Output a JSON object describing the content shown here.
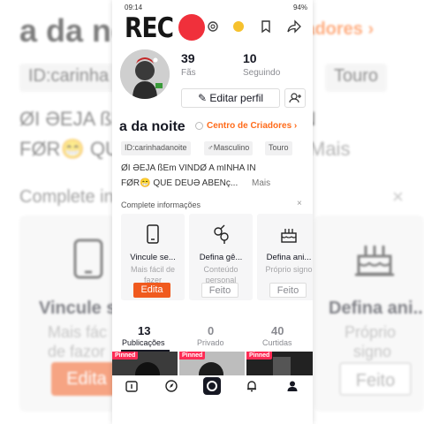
{
  "status_bar": {
    "time": "09:14",
    "battery": "94%"
  },
  "overlay": {
    "rec_label": "REC"
  },
  "profile": {
    "following_count": "39",
    "following_label": "Fãs",
    "followers_count": "10",
    "followers_label": "Seguindo",
    "edit_profile_label": "Editar perfil",
    "nickname": "a da noite",
    "creator_center_label": "Centro de Criadores ›",
    "tags": [
      "ID:carinhadanoite",
      "♂Masculino",
      "Touro"
    ],
    "bio_line1": "ØI ƏEJA ßEm VINDØ A mINHA IN",
    "bio_line2": "FØR😁 QUE DEUƏ ABENç...",
    "bio_more": "Mais"
  },
  "complete_info": {
    "title": "Complete informações",
    "close": "×",
    "cards": [
      {
        "title": "Vincule se...",
        "subtitle": "Mais fácil de fazer",
        "button": "Edita",
        "button_style": "primary",
        "icon": "phone-icon"
      },
      {
        "title": "Defina gê...",
        "subtitle": "Conteúdo personal",
        "button": "Feito",
        "button_style": "done",
        "icon": "gender-icon"
      },
      {
        "title": "Defina ani...",
        "subtitle": "Próprio signo",
        "button": "Feito",
        "button_style": "done",
        "icon": "cake-icon"
      }
    ]
  },
  "content_tabs": [
    {
      "count": "13",
      "label": "Publicações"
    },
    {
      "count": "0",
      "label": "Privado"
    },
    {
      "count": "40",
      "label": "Curtidas"
    }
  ],
  "videos": {
    "pinned_label": "Pinned"
  },
  "background": {
    "title": "a da no",
    "centro": "riadores ›",
    "id_pill": "ID:carinha",
    "touro_pill": "Touro",
    "bio1": "ØI ƏEJA ßEm VINDØ A mINHA IN",
    "bio2": "FØR😁 QU",
    "mais": "Mais",
    "complete": "Complete in",
    "close": "×",
    "card1_title": "Vincule s",
    "card1_sub": "Mais fác",
    "card1_sub2": "de fazor",
    "card1_button": "Edita",
    "card3_title": "Defina ani...",
    "card3_sub": "Próprio",
    "card3_sub2": "signo",
    "card3_button": "Feito"
  },
  "colors": {
    "accent": "#f05a1e",
    "creator_orange": "#ff6b1a",
    "pinned_red": "#fe2c55",
    "rec_red": "#f0303b"
  }
}
